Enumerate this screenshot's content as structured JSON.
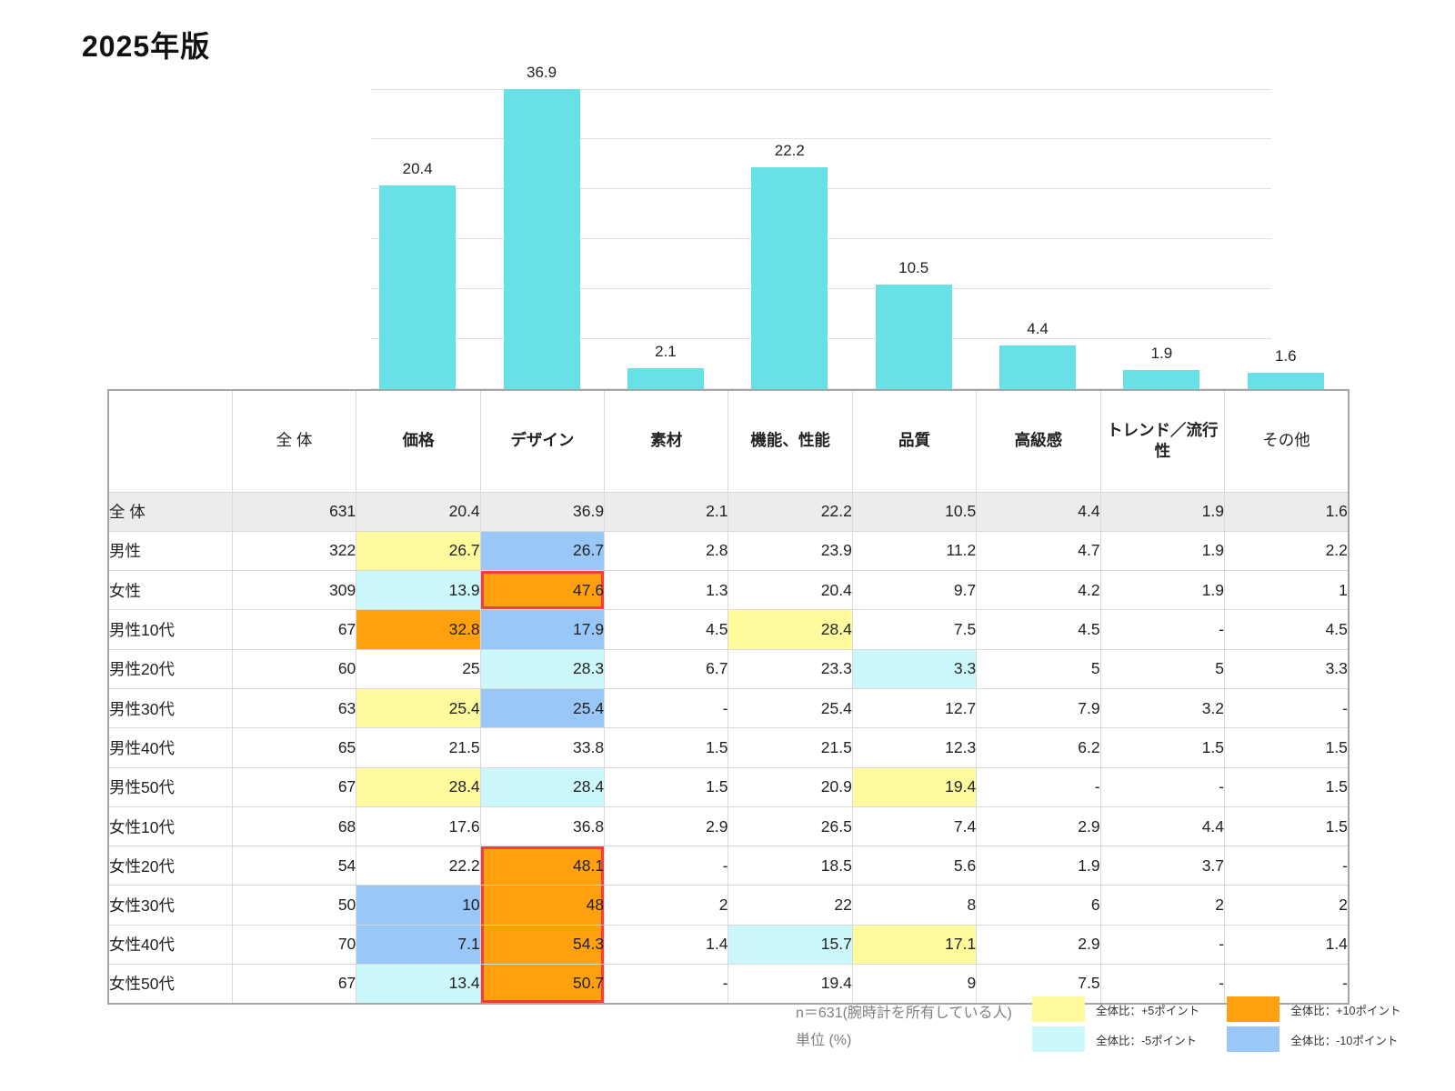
{
  "title": "2025年版",
  "chart_data": {
    "type": "bar",
    "title": "",
    "xlabel": "",
    "ylabel": "",
    "categories": [
      "価格",
      "デザイン",
      "素材",
      "機能、性能",
      "品質",
      "高級感",
      "トレンド／流行性",
      "その他"
    ],
    "values": [
      20.4,
      36.9,
      2.1,
      22.2,
      10.5,
      4.4,
      1.9,
      1.6
    ],
    "ylim": [
      0,
      30
    ],
    "gridline_step": 5,
    "grid": true,
    "legend_position": "none",
    "bar_color": "#67E1E6",
    "value_labels": [
      20.4,
      36.9,
      2.1,
      22.2,
      10.5,
      4.4,
      1.9,
      1.6
    ]
  },
  "table": {
    "columns": [
      {
        "label": "全 体",
        "bold": false
      },
      {
        "label": "価格",
        "bold": true
      },
      {
        "label": "デザイン",
        "bold": true
      },
      {
        "label": "素材",
        "bold": true
      },
      {
        "label": "機能、性能",
        "bold": true
      },
      {
        "label": "品質",
        "bold": true
      },
      {
        "label": "高級感",
        "bold": true
      },
      {
        "label": "トレンド／流行性",
        "bold": true
      },
      {
        "label": "その他",
        "bold": false
      }
    ],
    "rows": [
      {
        "label": "全 体",
        "n": "631",
        "shaded": true,
        "values": [
          "20.4",
          "36.9",
          "2.1",
          "22.2",
          "10.5",
          "4.4",
          "1.9",
          "1.6"
        ],
        "highlights": [
          "",
          "",
          "",
          "",
          "",
          "",
          "",
          ""
        ],
        "red": [
          "",
          "",
          "",
          "",
          "",
          "",
          "",
          ""
        ]
      },
      {
        "label": "男性",
        "n": "322",
        "shaded": false,
        "values": [
          "26.7",
          "26.7",
          "2.8",
          "23.9",
          "11.2",
          "4.7",
          "1.9",
          "2.2"
        ],
        "highlights": [
          "plus5",
          "minus10",
          "",
          "",
          "",
          "",
          "",
          ""
        ],
        "red": [
          "",
          "",
          "",
          "",
          "",
          "",
          "",
          ""
        ]
      },
      {
        "label": "女性",
        "n": "309",
        "shaded": false,
        "values": [
          "13.9",
          "47.6",
          "1.3",
          "20.4",
          "9.7",
          "4.2",
          "1.9",
          "1"
        ],
        "highlights": [
          "minus5",
          "plus10",
          "",
          "",
          "",
          "",
          "",
          ""
        ],
        "red": [
          "",
          "single",
          "",
          "",
          "",
          "",
          "",
          ""
        ]
      },
      {
        "label": "男性10代",
        "n": "67",
        "shaded": false,
        "values": [
          "32.8",
          "17.9",
          "4.5",
          "28.4",
          "7.5",
          "4.5",
          "-",
          "4.5"
        ],
        "highlights": [
          "plus10",
          "minus10",
          "",
          "plus5",
          "",
          "",
          "",
          ""
        ],
        "red": [
          "",
          "",
          "",
          "",
          "",
          "",
          "",
          ""
        ]
      },
      {
        "label": "男性20代",
        "n": "60",
        "shaded": false,
        "values": [
          "25",
          "28.3",
          "6.7",
          "23.3",
          "3.3",
          "5",
          "5",
          "3.3"
        ],
        "highlights": [
          "",
          "minus5",
          "",
          "",
          "minus5",
          "",
          "",
          ""
        ],
        "red": [
          "",
          "",
          "",
          "",
          "",
          "",
          "",
          ""
        ]
      },
      {
        "label": "男性30代",
        "n": "63",
        "shaded": false,
        "values": [
          "25.4",
          "25.4",
          "-",
          "25.4",
          "12.7",
          "7.9",
          "3.2",
          "-"
        ],
        "highlights": [
          "plus5",
          "minus10",
          "",
          "",
          "",
          "",
          "",
          ""
        ],
        "red": [
          "",
          "",
          "",
          "",
          "",
          "",
          "",
          ""
        ]
      },
      {
        "label": "男性40代",
        "n": "65",
        "shaded": false,
        "values": [
          "21.5",
          "33.8",
          "1.5",
          "21.5",
          "12.3",
          "6.2",
          "1.5",
          "1.5"
        ],
        "highlights": [
          "",
          "",
          "",
          "",
          "",
          "",
          "",
          ""
        ],
        "red": [
          "",
          "",
          "",
          "",
          "",
          "",
          "",
          ""
        ]
      },
      {
        "label": "男性50代",
        "n": "67",
        "shaded": false,
        "values": [
          "28.4",
          "28.4",
          "1.5",
          "20.9",
          "19.4",
          "-",
          "-",
          "1.5"
        ],
        "highlights": [
          "plus5",
          "minus5",
          "",
          "",
          "plus5",
          "",
          "",
          ""
        ],
        "red": [
          "",
          "",
          "",
          "",
          "",
          "",
          "",
          ""
        ]
      },
      {
        "label": "女性10代",
        "n": "68",
        "shaded": false,
        "values": [
          "17.6",
          "36.8",
          "2.9",
          "26.5",
          "7.4",
          "2.9",
          "4.4",
          "1.5"
        ],
        "highlights": [
          "",
          "",
          "",
          "",
          "",
          "",
          "",
          ""
        ],
        "red": [
          "",
          "",
          "",
          "",
          "",
          "",
          "",
          ""
        ]
      },
      {
        "label": "女性20代",
        "n": "54",
        "shaded": false,
        "values": [
          "22.2",
          "48.1",
          "-",
          "18.5",
          "5.6",
          "1.9",
          "3.7",
          "-"
        ],
        "highlights": [
          "",
          "plus10",
          "",
          "",
          "",
          "",
          "",
          ""
        ],
        "red": [
          "",
          "top",
          "",
          "",
          "",
          "",
          "",
          ""
        ]
      },
      {
        "label": "女性30代",
        "n": "50",
        "shaded": false,
        "values": [
          "10",
          "48",
          "2",
          "22",
          "8",
          "6",
          "2",
          "2"
        ],
        "highlights": [
          "minus10",
          "plus10",
          "",
          "",
          "",
          "",
          "",
          ""
        ],
        "red": [
          "",
          "mid",
          "",
          "",
          "",
          "",
          "",
          ""
        ]
      },
      {
        "label": "女性40代",
        "n": "70",
        "shaded": false,
        "values": [
          "7.1",
          "54.3",
          "1.4",
          "15.7",
          "17.1",
          "2.9",
          "-",
          "1.4"
        ],
        "highlights": [
          "minus10",
          "plus10",
          "",
          "minus5",
          "plus5",
          "",
          "",
          ""
        ],
        "red": [
          "",
          "mid",
          "",
          "",
          "",
          "",
          "",
          ""
        ]
      },
      {
        "label": "女性50代",
        "n": "67",
        "shaded": false,
        "values": [
          "13.4",
          "50.7",
          "-",
          "19.4",
          "9",
          "7.5",
          "-",
          "-"
        ],
        "highlights": [
          "minus5",
          "plus10",
          "",
          "",
          "",
          "",
          "",
          ""
        ],
        "red": [
          "",
          "bottom",
          "",
          "",
          "",
          "",
          "",
          ""
        ]
      }
    ]
  },
  "footnote": {
    "line1": "n＝631(腕時計を所有している人)",
    "line2": "単位 (%)"
  },
  "legend": {
    "items": [
      {
        "type": "plus5",
        "color": "#FFFA9D",
        "label": "全体比：+5ポイント"
      },
      {
        "type": "minus5",
        "color": "#CDF8FB",
        "label": "全体比：-5ポイント"
      },
      {
        "type": "plus10",
        "color": "#FFA00F",
        "label": "全体比：+10ポイント"
      },
      {
        "type": "minus10",
        "color": "#99C7F7",
        "label": "全体比：-10ポイント"
      }
    ]
  },
  "colors": {
    "bar": "#67E1E6",
    "gridline": "#E2E2E2",
    "shaded_row": "#ECECEC",
    "red_border": "#FA3B3B",
    "table_outer_border": "#A6A6A6",
    "table_inner_border": "#D9D9D9"
  }
}
